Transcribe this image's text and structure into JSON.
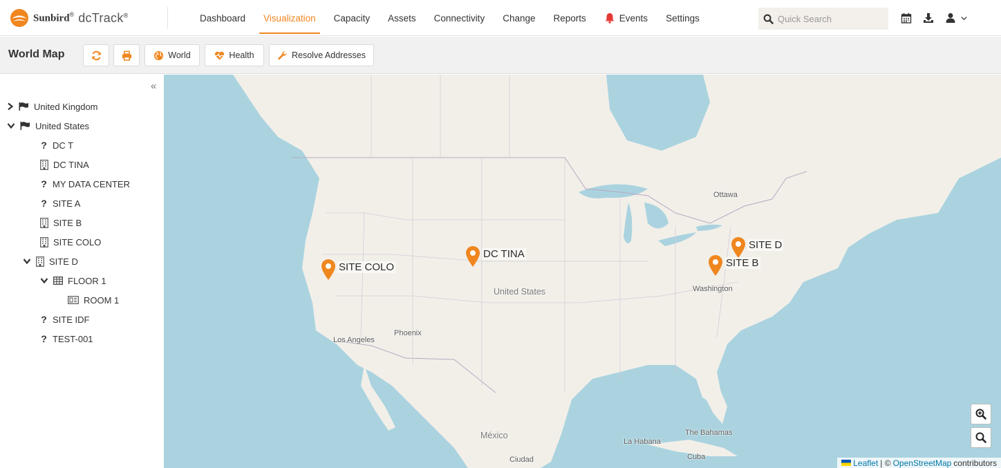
{
  "brand": {
    "name": "Sunbird",
    "reg1": "®",
    "product": "dcTrack",
    "reg2": "®",
    "logo_color": "#f0861e"
  },
  "nav": {
    "items": [
      {
        "label": "Dashboard"
      },
      {
        "label": "Visualization",
        "active": true
      },
      {
        "label": "Capacity"
      },
      {
        "label": "Assets"
      },
      {
        "label": "Connectivity"
      },
      {
        "label": "Change"
      },
      {
        "label": "Reports"
      },
      {
        "label": "Events",
        "icon": "bell-icon"
      },
      {
        "label": "Settings"
      }
    ],
    "search": {
      "placeholder": "Quick Search"
    },
    "icons": [
      "calendar-icon",
      "download-icon",
      "user-icon",
      "chevron-down-icon"
    ]
  },
  "toolbar": {
    "title": "World Map",
    "buttons": [
      {
        "icon": "refresh-icon"
      },
      {
        "icon": "print-icon"
      },
      {
        "icon": "globe-icon",
        "label": "World"
      },
      {
        "icon": "heartbeat-icon",
        "label": "Health"
      },
      {
        "icon": "wrench-icon",
        "label": "Resolve Addresses"
      }
    ]
  },
  "tree": {
    "collapse_glyph": "«",
    "items": [
      {
        "label": "United Kingdom",
        "type": "country",
        "expanded": false
      },
      {
        "label": "United States",
        "type": "country",
        "expanded": true
      },
      {
        "label": "DC T",
        "type": "unknown"
      },
      {
        "label": "DC TINA",
        "type": "building"
      },
      {
        "label": "MY DATA CENTER",
        "type": "unknown"
      },
      {
        "label": "SITE A",
        "type": "unknown"
      },
      {
        "label": "SITE B",
        "type": "building"
      },
      {
        "label": "SITE COLO",
        "type": "building"
      },
      {
        "label": "SITE D",
        "type": "building",
        "expanded": true
      },
      {
        "label": "FLOOR 1",
        "type": "floor",
        "expanded": true
      },
      {
        "label": "ROOM 1",
        "type": "room"
      },
      {
        "label": "SITE IDF",
        "type": "unknown"
      },
      {
        "label": "TEST-001",
        "type": "unknown"
      }
    ]
  },
  "map": {
    "markers": [
      {
        "label": "SITE COLO"
      },
      {
        "label": "DC TINA"
      },
      {
        "label": "SITE D"
      },
      {
        "label": "SITE B"
      }
    ],
    "marker_color": "#f0861e",
    "place_labels": {
      "ottawa": "Ottawa",
      "united_states": "United States",
      "washington": "Washington",
      "los_angeles": "Los Angeles",
      "phoenix": "Phoenix",
      "mexico": "México",
      "la_habana": "La Habana",
      "bahamas": "The Bahamas",
      "cuba": "Cuba",
      "ciudad": "Ciudad"
    },
    "attribution": {
      "leaflet": "Leaflet",
      "separator": " | © ",
      "osm": "OpenStreetMap",
      "suffix": " contributors"
    }
  }
}
